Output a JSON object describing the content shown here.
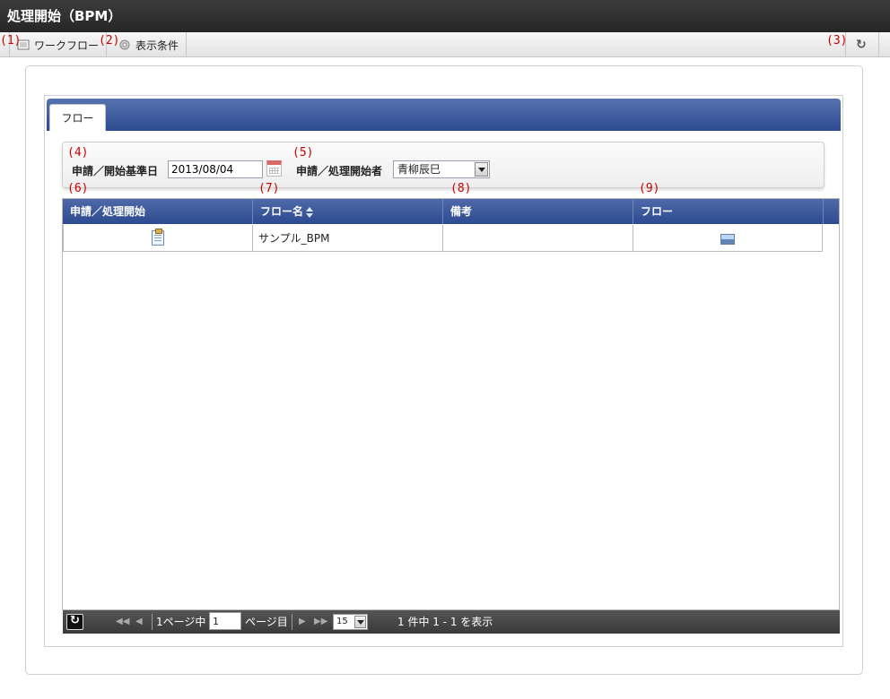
{
  "window": {
    "title": "処理開始（BPM）"
  },
  "toolbar": {
    "workflow_label": "ワークフロー",
    "display_cond_label": "表示条件",
    "workflow_icon": "list-icon",
    "display_cond_icon": "gear-icon",
    "refresh_icon": "refresh-icon"
  },
  "annotations": [
    "(1)",
    "(2)",
    "(3)",
    "(4)",
    "(5)",
    "(6)",
    "(7)",
    "(8)",
    "(9)"
  ],
  "tabs": [
    {
      "label": "フロー"
    }
  ],
  "search": {
    "date_label": "申請／開始基準日",
    "date_value": "2013/08/04",
    "user_label": "申請／処理開始者",
    "user_value": "青柳辰巳"
  },
  "grid": {
    "columns": [
      "申請／処理開始",
      "フロー名",
      "備考",
      "フロー"
    ],
    "rows": [
      {
        "start_icon": "clipboard-icon",
        "flow_name": "サンプル_BPM",
        "note": "",
        "flow_icon": "image-icon"
      }
    ]
  },
  "pager": {
    "page_prefix": "1ページ中",
    "page_value": "1",
    "page_suffix": "ページ目",
    "page_size": "15",
    "summary": "1 件中 1 - 1 を表示"
  },
  "colors": {
    "header_blue": "#2c4a91",
    "annotation_red": "#cc0000",
    "titlebar": "#2b2b2b"
  }
}
